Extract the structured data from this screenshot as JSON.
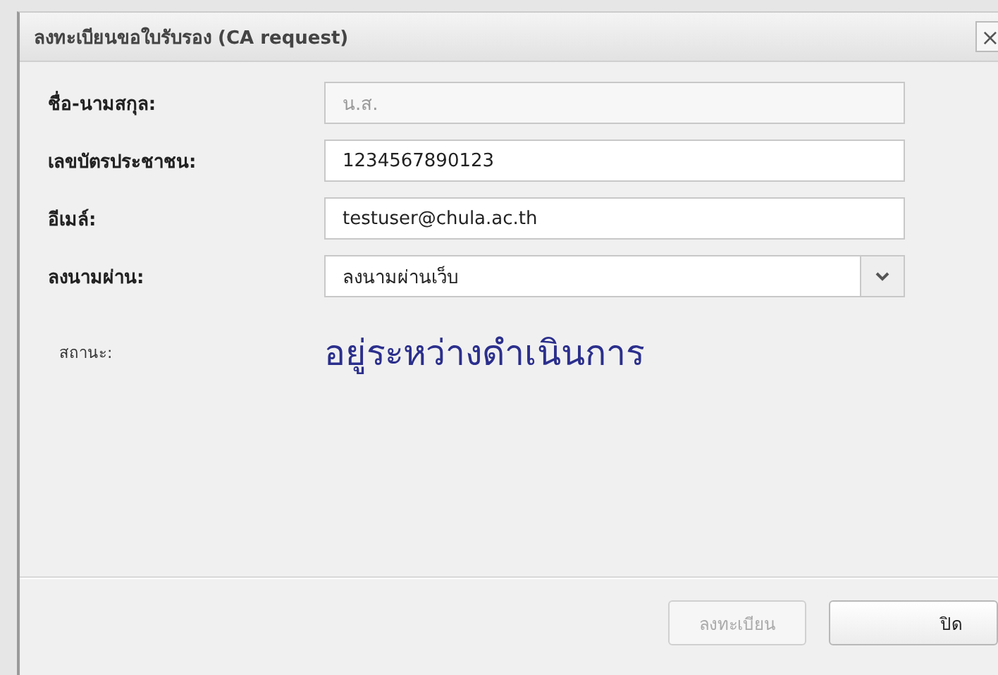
{
  "window": {
    "title": "ลงทะเบียนขอใบรับรอง (CA request)",
    "close": "×"
  },
  "fields": [
    {
      "kind": "text",
      "label": "ชื่อ-นามสกุล:",
      "value": "น.ส.",
      "disabled": true
    },
    {
      "kind": "text",
      "label": "เลขบัตรประชาชน:",
      "value": "1234567890123",
      "disabled": false
    },
    {
      "kind": "text",
      "label": "อีเมล์:",
      "value": "testuser@chula.ac.th",
      "disabled": false
    },
    {
      "kind": "select",
      "label": "ลงนามผ่าน:",
      "value": "ลงนามผ่านเว็บ",
      "disabled": false
    }
  ],
  "status": {
    "label": "สถานะ:",
    "value": "อยู่ระหว่างดำเนินการ"
  },
  "buttons": [
    {
      "label": "ลงทะเบียน",
      "disabled": true
    },
    {
      "label": "ปิด",
      "disabled": false
    }
  ]
}
